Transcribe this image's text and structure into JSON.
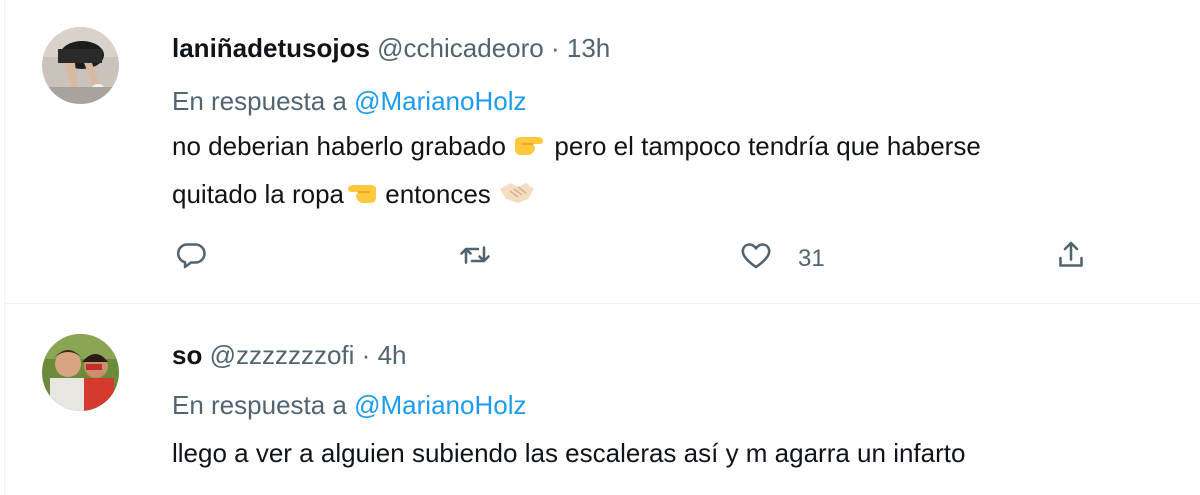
{
  "tweets": [
    {
      "name": "laniñadetusojos",
      "handle": "@cchicadeoro",
      "sep": "·",
      "time": "13h",
      "reply_prefix": "En respuesta a",
      "reply_to": "@MarianoHolz",
      "text_line1a": "no deberian haberlo grabado",
      "text_line1b": "pero el tampoco tendría que haberse",
      "text_line2a": "quitado la ropa",
      "text_line2b": "entonces",
      "emoji_1": "pointing-right-hand-icon",
      "emoji_2": "pointing-left-hand-icon",
      "emoji_3": "handshake-icon",
      "likes": "31"
    },
    {
      "name": "so",
      "handle": "@zzzzzzzofi",
      "sep": "·",
      "time": "4h",
      "reply_prefix": "En respuesta a",
      "reply_to": "@MarianoHolz",
      "text": "llego a ver a alguien subiendo las escaleras así y m agarra un infarto"
    }
  ],
  "colors": {
    "text": "#0f1419",
    "secondary": "#536471",
    "link": "#1d9bf0",
    "border": "#eff3f4"
  }
}
